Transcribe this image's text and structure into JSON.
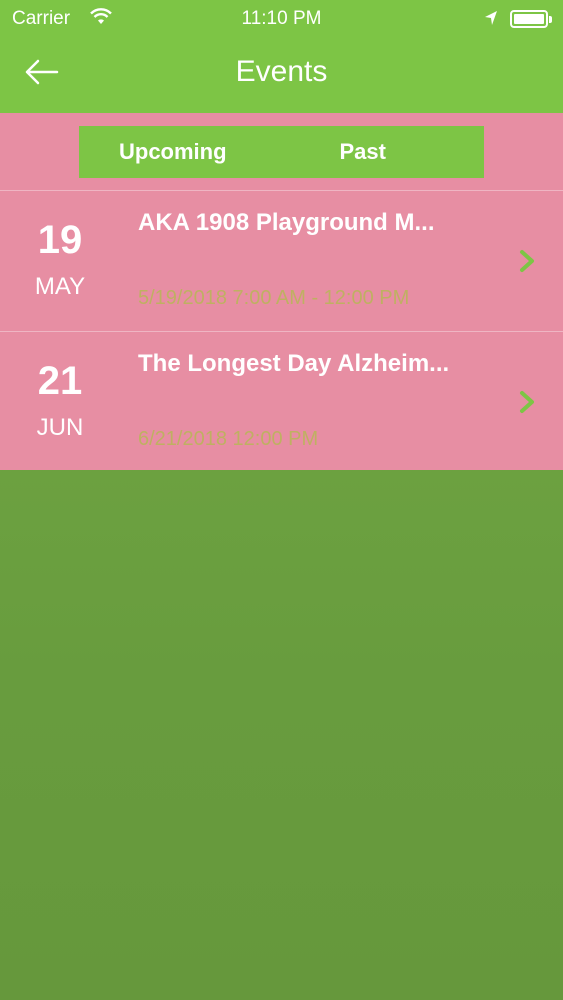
{
  "status_bar": {
    "carrier": "Carrier",
    "time": "11:10 PM"
  },
  "nav": {
    "title": "Events",
    "back_icon": "arrow-left-icon"
  },
  "segments": {
    "upcoming": "Upcoming",
    "past": "Past",
    "selected": "upcoming"
  },
  "events": [
    {
      "day": "19",
      "month": "MAY",
      "title": "AKA 1908 Playground M...",
      "when": "5/19/2018 7:00 AM - 12:00 PM"
    },
    {
      "day": "21",
      "month": "JUN",
      "title": "The Longest Day Alzheim...",
      "when": "6/21/2018 12:00 PM"
    }
  ],
  "colors": {
    "header": "#7dc545",
    "panel": "#e78ea3",
    "background": "#6a9a3f",
    "accent": "#7dc545",
    "datetime": "#bfb062"
  }
}
